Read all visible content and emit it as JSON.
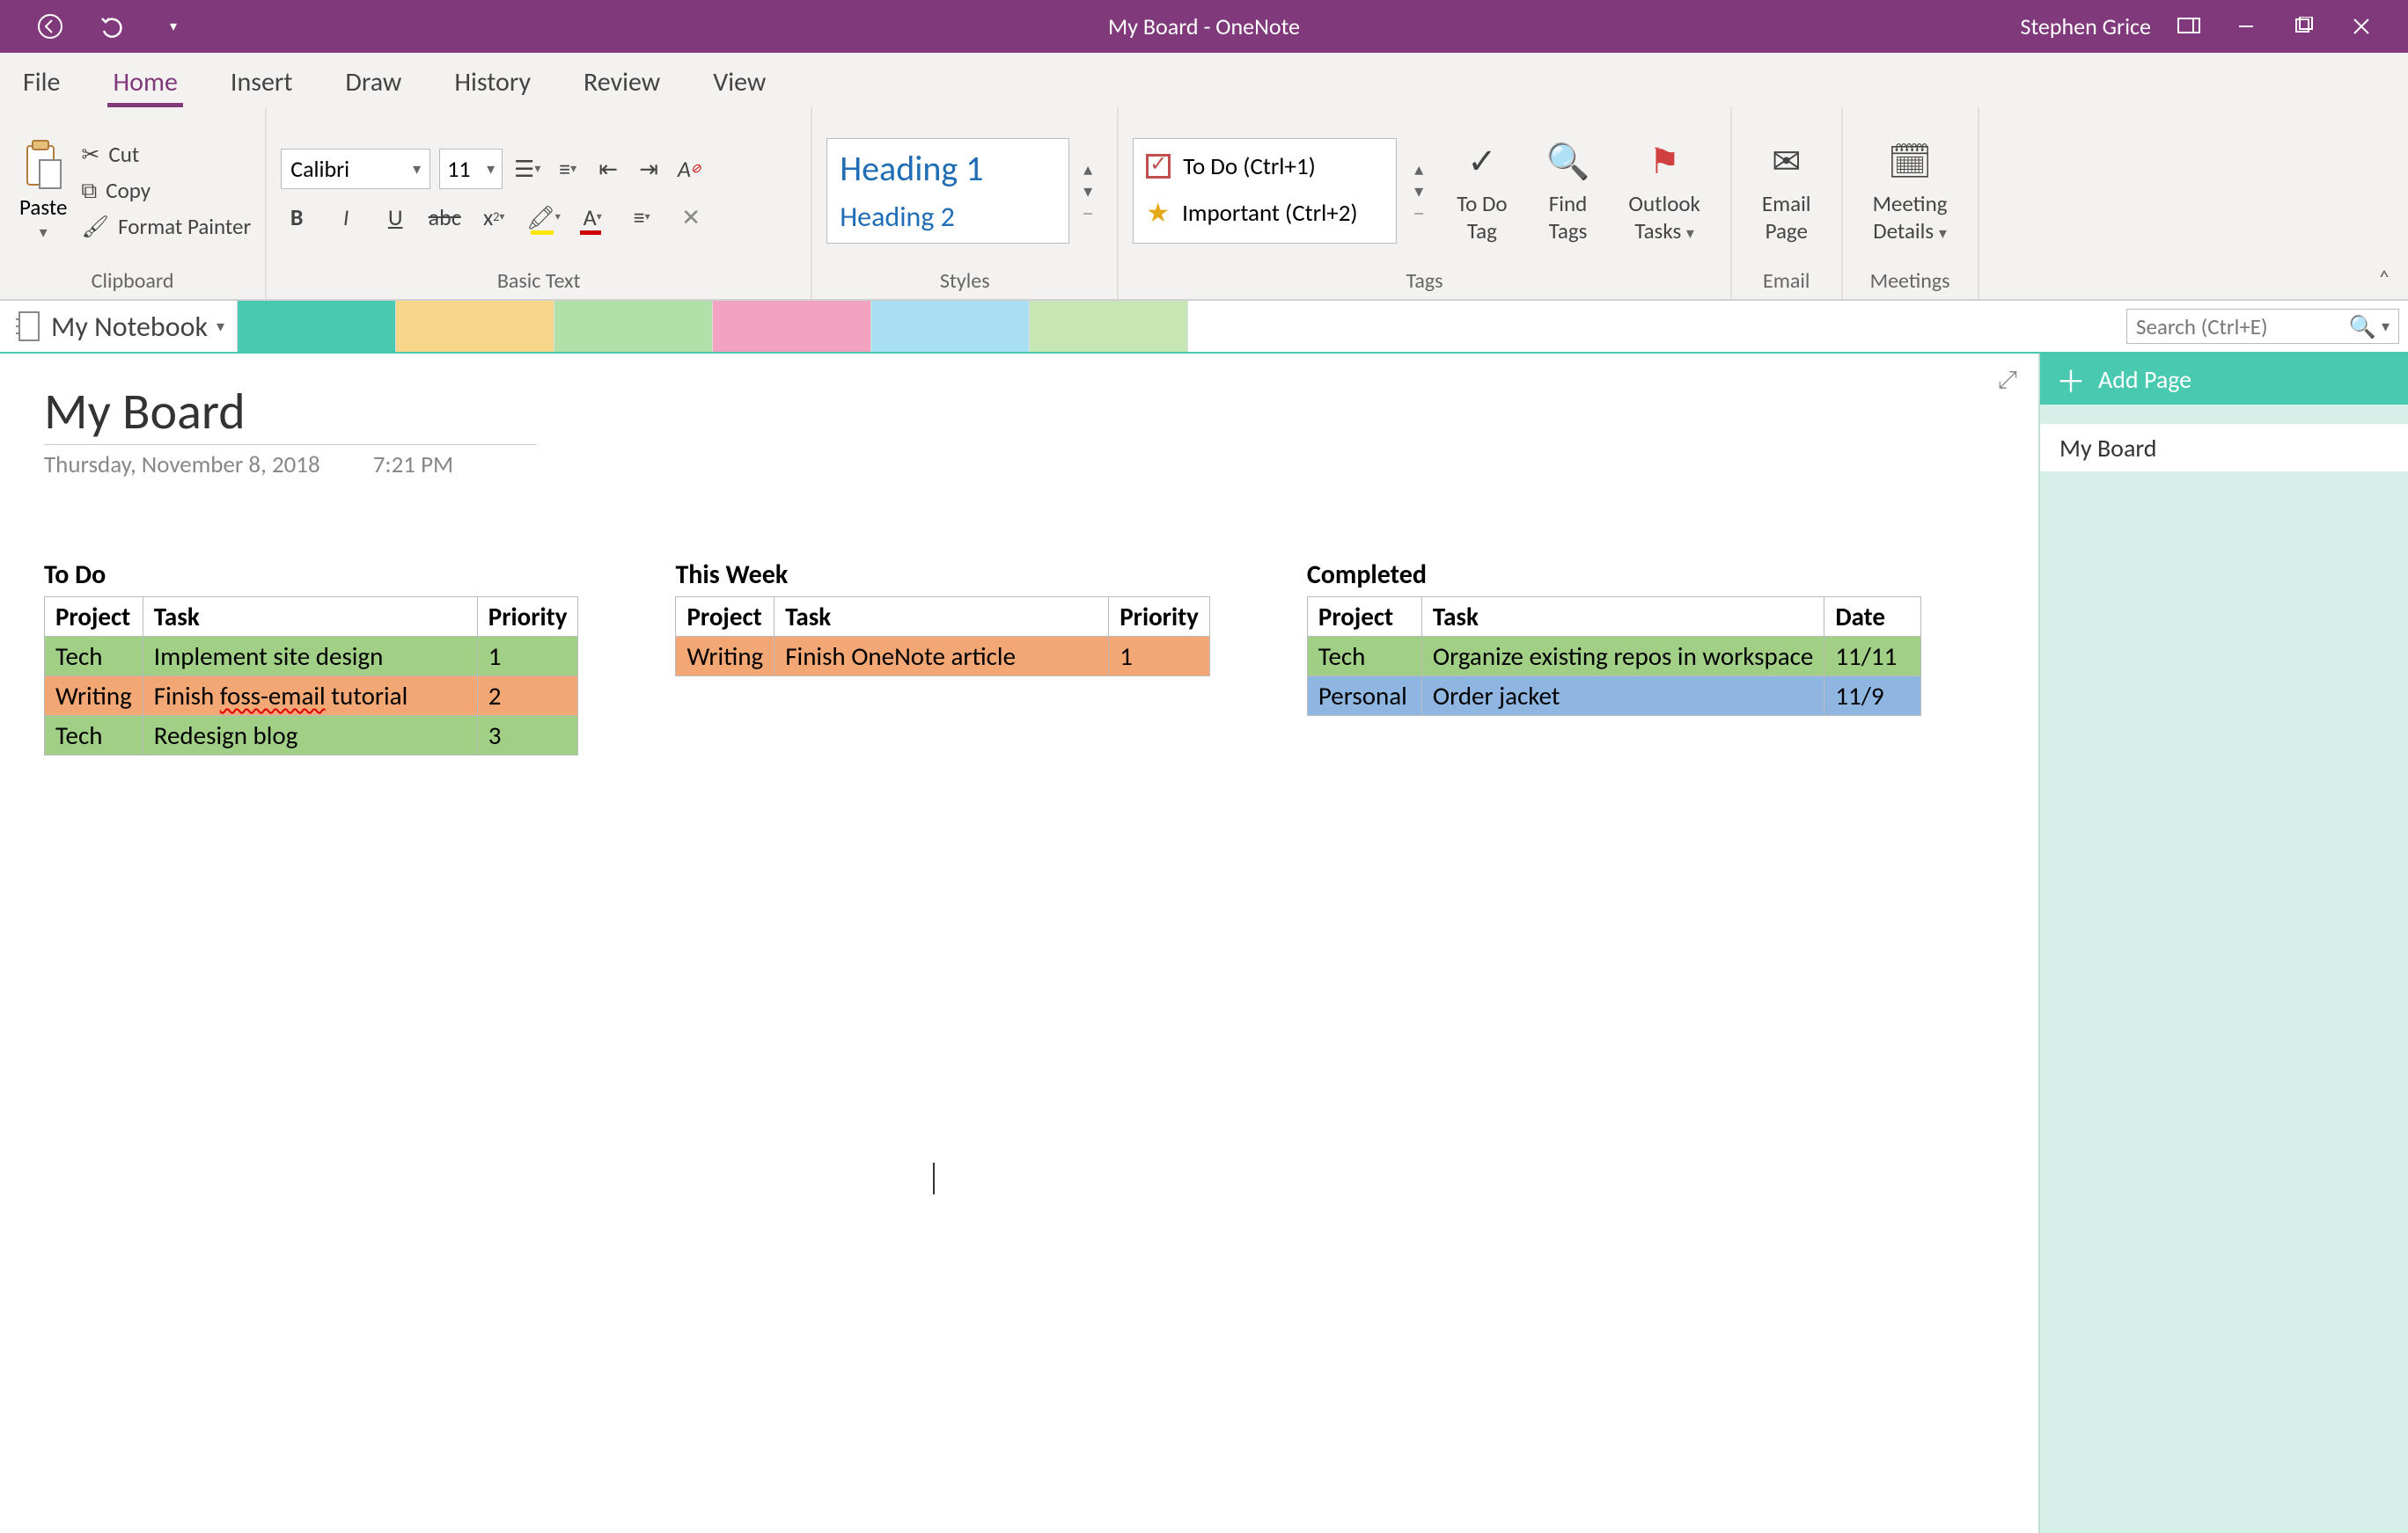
{
  "titlebar": {
    "title": "My Board  -  OneNote",
    "user": "Stephen Grice"
  },
  "menutabs": [
    "File",
    "Home",
    "Insert",
    "Draw",
    "History",
    "Review",
    "View"
  ],
  "menutab_active": 1,
  "ribbon": {
    "clipboard": {
      "paste": "Paste",
      "cut": "Cut",
      "copy": "Copy",
      "format_painter": "Format Painter",
      "label": "Clipboard"
    },
    "font": {
      "name": "Calibri",
      "size": "11",
      "label": "Basic Text"
    },
    "styles": {
      "h1": "Heading 1",
      "h2": "Heading 2",
      "label": "Styles"
    },
    "tags": {
      "todo": "To Do (Ctrl+1)",
      "important": "Important (Ctrl+2)",
      "todo_tag": "To Do\nTag",
      "find": "Find\nTags",
      "outlook": "Outlook\nTasks",
      "label": "Tags"
    },
    "email": {
      "btn": "Email\nPage",
      "label": "Email"
    },
    "meetings": {
      "btn": "Meeting\nDetails",
      "label": "Meetings"
    }
  },
  "notebook": "My Notebook",
  "search_placeholder": "Search (Ctrl+E)",
  "page": {
    "title": "My Board",
    "date": "Thursday, November 8, 2018",
    "time": "7:21 PM"
  },
  "pagepanel": {
    "add": "Add Page",
    "pages": [
      "My Board"
    ]
  },
  "boards": [
    {
      "title": "To Do",
      "cols": [
        "Project",
        "Task",
        "Priority"
      ],
      "rows": [
        {
          "class": "row-green",
          "cells": [
            "Tech",
            "Implement site design",
            "1"
          ]
        },
        {
          "class": "row-orange",
          "cells": [
            "Writing",
            "Finish foss-email tutorial",
            "2"
          ],
          "spell": 1
        },
        {
          "class": "row-green",
          "cells": [
            "Tech",
            "Redesign blog",
            "3"
          ]
        }
      ],
      "widths": [
        110,
        380,
        110
      ]
    },
    {
      "title": "This Week",
      "cols": [
        "Project",
        "Task",
        "Priority"
      ],
      "rows": [
        {
          "class": "row-orange",
          "cells": [
            "Writing",
            "Finish OneNote article",
            "1"
          ]
        }
      ],
      "widths": [
        110,
        380,
        110
      ]
    },
    {
      "title": "Completed",
      "cols": [
        "Project",
        "Task",
        "Date"
      ],
      "rows": [
        {
          "class": "row-green",
          "cells": [
            "Tech",
            "Organize existing repos in workspace",
            "11/11"
          ]
        },
        {
          "class": "row-blue",
          "cells": [
            "Personal",
            "Order jacket",
            "11/9"
          ]
        }
      ],
      "widths": [
        130,
        380,
        110
      ]
    }
  ]
}
